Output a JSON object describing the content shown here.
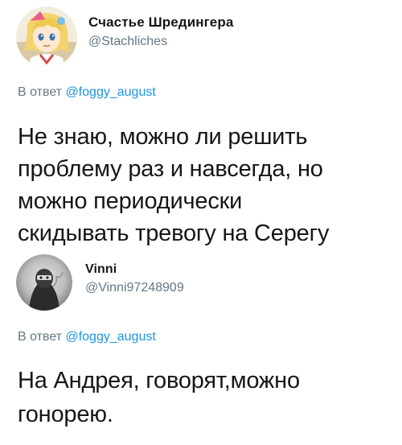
{
  "tweets": [
    {
      "author": {
        "display_name": "Счастье Шредингера",
        "handle": "@Stachliches",
        "avatar_icon": "anime-character-avatar"
      },
      "reply": {
        "prefix": "В ответ",
        "mention": "@foggy_august"
      },
      "text_lines": [
        "Не знаю, можно ли решить",
        "проблему раз и навсегда, но",
        "можно периодически",
        "скидывать тревогу на Серегу"
      ]
    },
    {
      "author": {
        "display_name": "Vinni",
        "handle": "@Vinni97248909",
        "avatar_icon": "dark-figure-avatar"
      },
      "reply": {
        "prefix": "В ответ",
        "mention": "@foggy_august"
      },
      "text_lines": [
        "На Андрея, говорят,можно",
        "гонорею."
      ]
    }
  ],
  "colors": {
    "text_primary": "#14171a",
    "text_secondary": "#657786",
    "mention": "#1b95e0",
    "background": "#ffffff"
  }
}
